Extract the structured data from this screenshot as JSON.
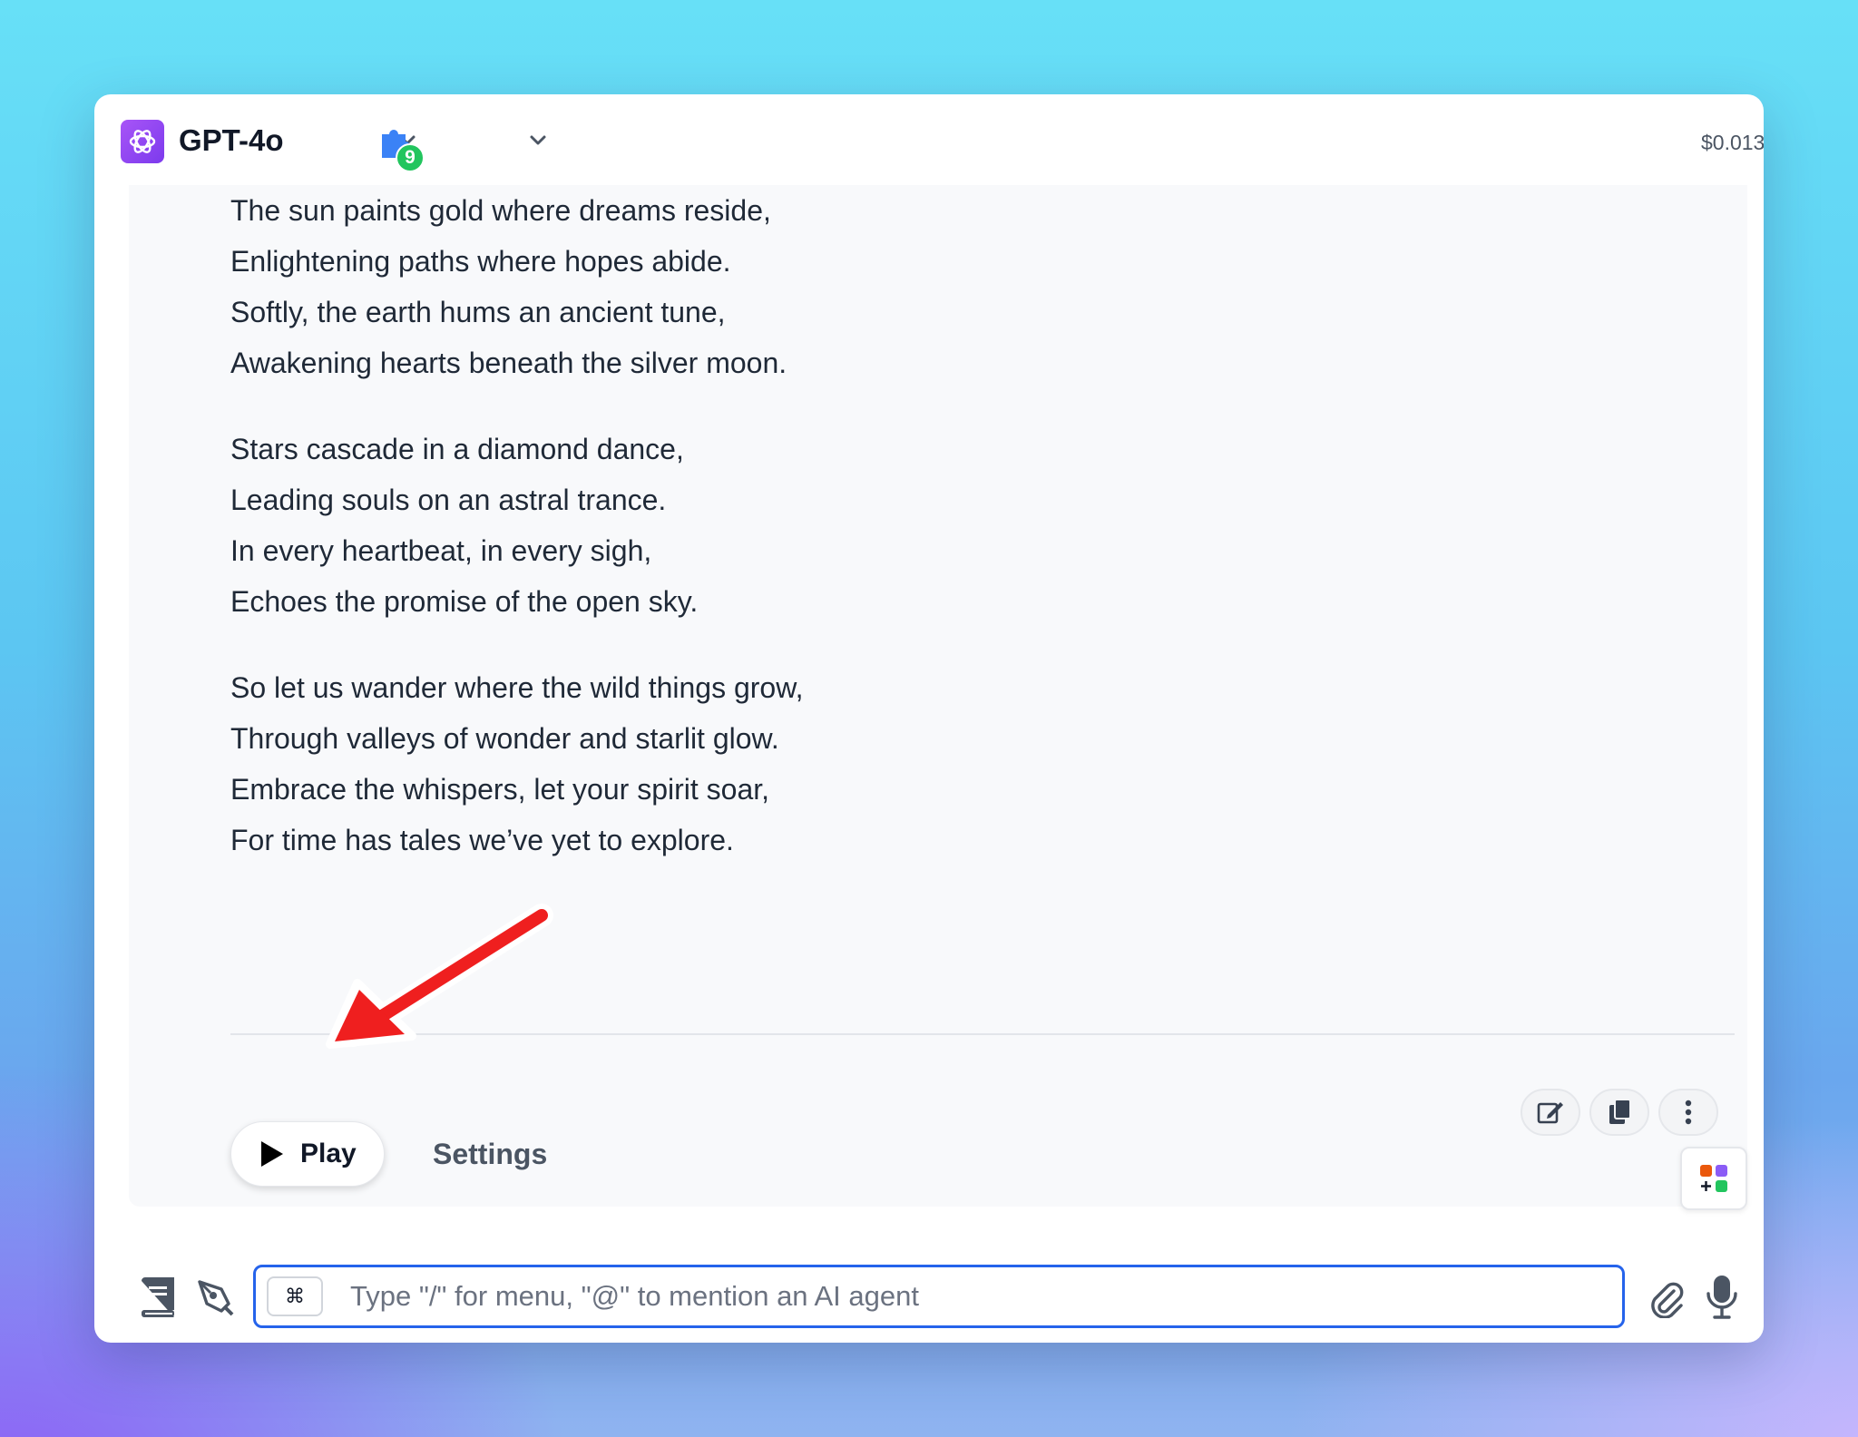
{
  "header": {
    "model_name": "GPT-4o",
    "plugin_count": "9",
    "cost": "$0.013"
  },
  "message": {
    "stanzas": [
      [
        "The sun paints gold where dreams reside,",
        "Enlightening paths where hopes abide.",
        "Softly, the earth hums an ancient tune,",
        "Awakening hearts beneath the silver moon."
      ],
      [
        "Stars cascade in a diamond dance,",
        "Leading souls on an astral trance.",
        "In every heartbeat, in every sigh,",
        "Echoes the promise of the open sky."
      ],
      [
        "So let us wander where the wild things grow,",
        "Through valleys of wonder and starlit glow.",
        "Embrace the whispers, let your spirit soar,",
        "For time has tales we’ve yet to explore."
      ]
    ],
    "play_label": "Play",
    "settings_label": "Settings"
  },
  "composer": {
    "shortcut_key": "⌘",
    "placeholder": "Type \"/\" for menu, \"@\" to mention an AI agent"
  },
  "colors": {
    "accent": "#2563eb",
    "logo": "#8b5cf6",
    "badge": "#22c55e",
    "annotation_arrow": "#ef1f1f"
  },
  "icons": [
    "openai-logo-icon",
    "chevron-down-icon",
    "puzzle-plugin-icon",
    "play-icon",
    "edit-icon",
    "copy-icon",
    "more-vertical-icon",
    "apps-grid-icon",
    "book-icon",
    "pen-tool-icon",
    "paperclip-icon",
    "microphone-icon",
    "annotation-arrow-icon"
  ]
}
